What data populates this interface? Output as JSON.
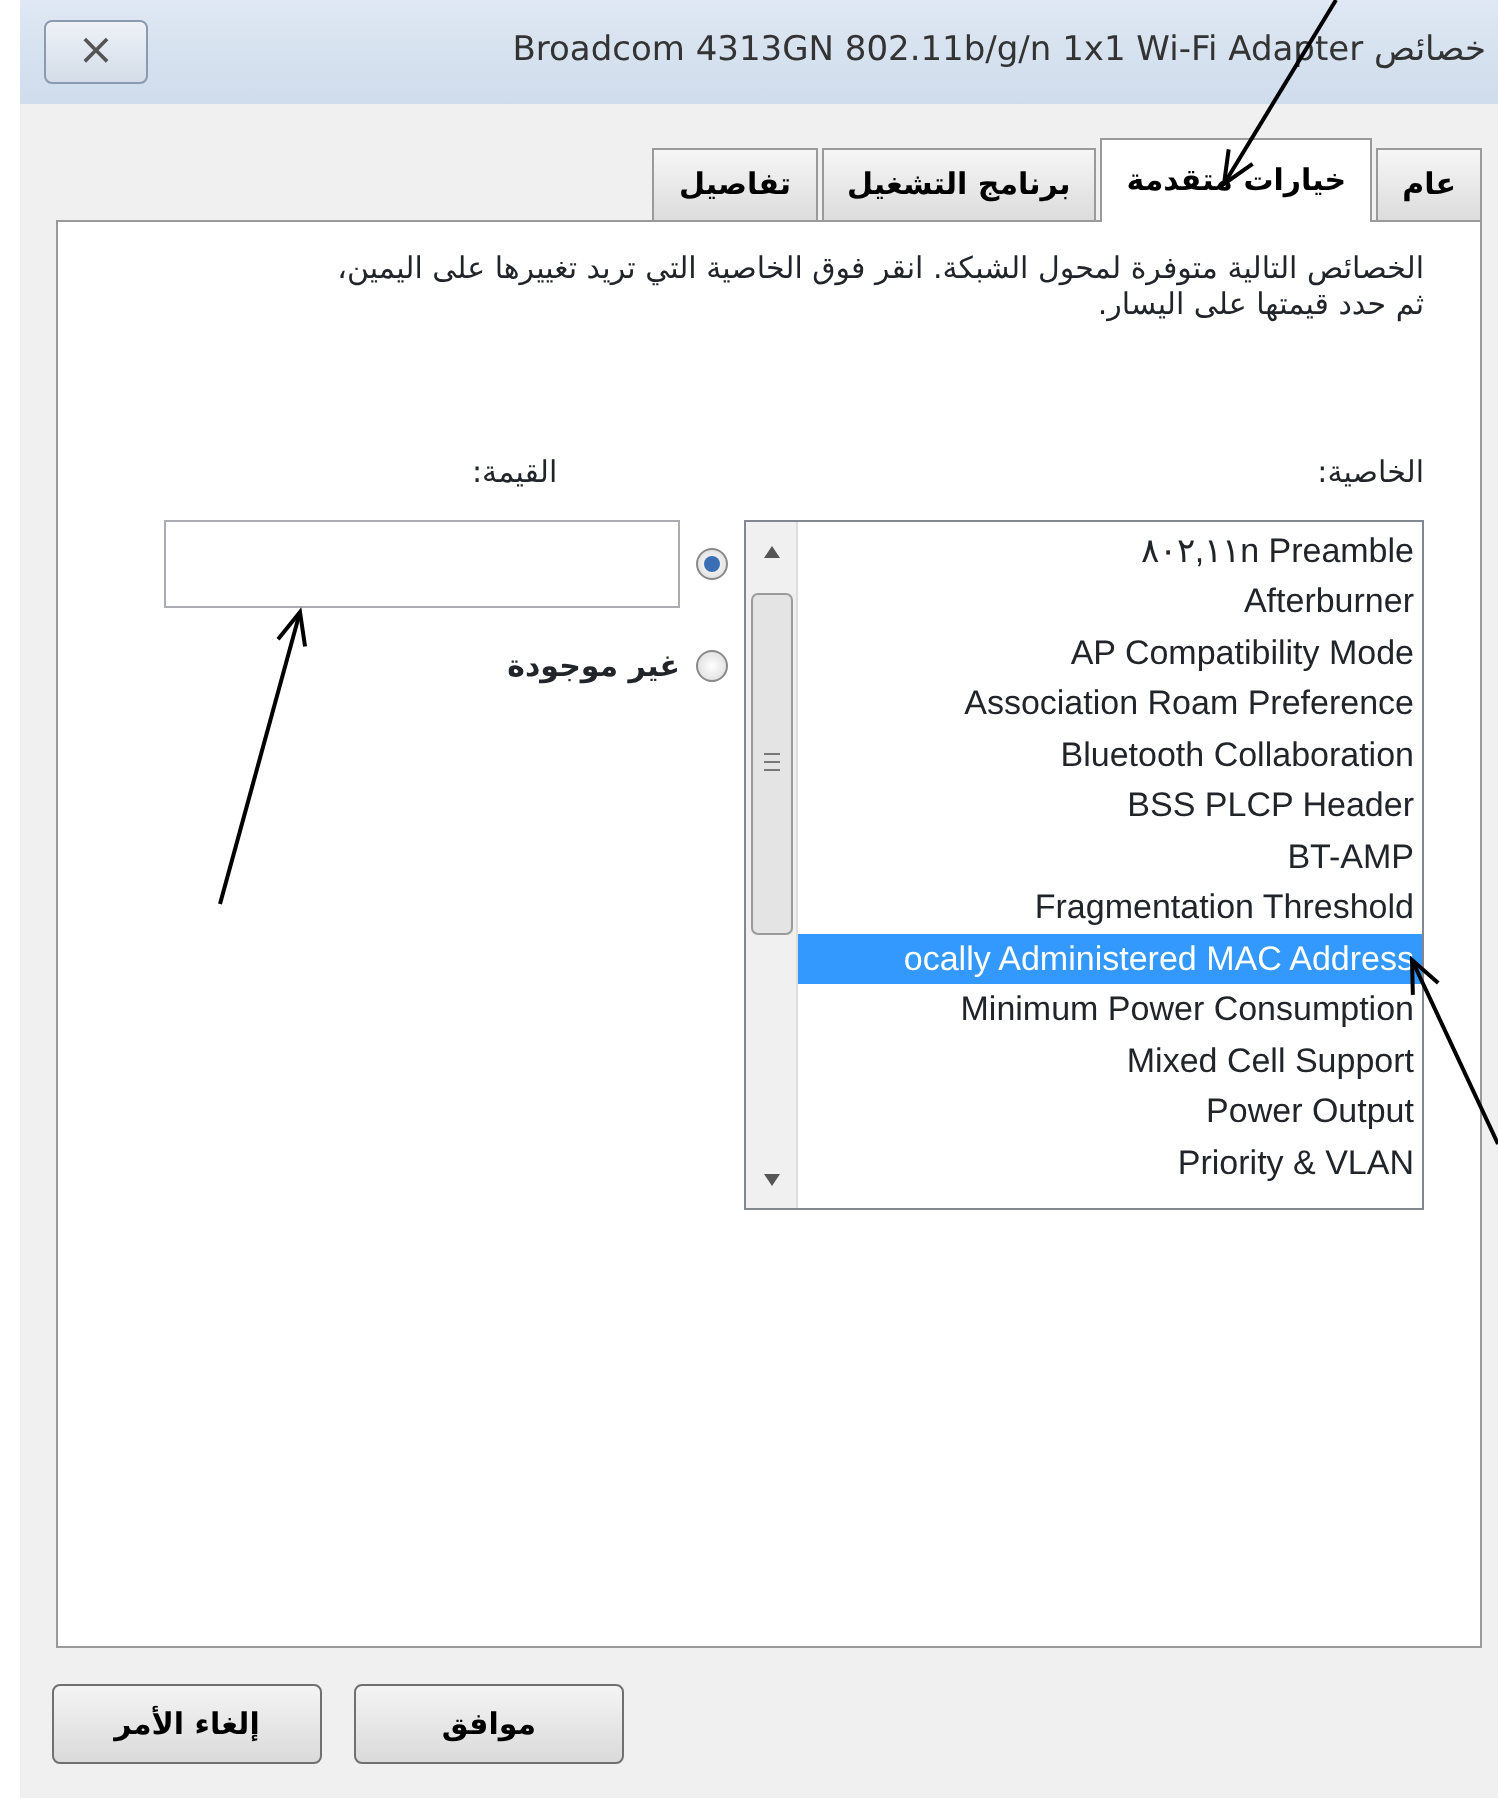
{
  "window": {
    "title": "خصائص Broadcom 4313GN 802.11b/g/n 1x1 Wi-Fi Adapter",
    "close_label": "×"
  },
  "tabs": [
    {
      "label": "عام",
      "selected": false
    },
    {
      "label": "خيارات متقدمة",
      "selected": true
    },
    {
      "label": "برنامج التشغيل",
      "selected": false
    },
    {
      "label": "تفاصيل",
      "selected": false
    }
  ],
  "description": "الخصائص التالية متوفرة لمحول الشبكة. انقر فوق الخاصية التي تريد تغييرها على اليمين، ثم حدد قيمتها على اليسار.",
  "property_label": "الخاصية:",
  "value_label": "القيمة:",
  "properties": [
    {
      "label": "٨٠٢,١١n Preamble",
      "selected": false
    },
    {
      "label": "Afterburner",
      "selected": false
    },
    {
      "label": "AP Compatibility Mode",
      "selected": false
    },
    {
      "label": "Association Roam Preference",
      "selected": false
    },
    {
      "label": "Bluetooth Collaboration",
      "selected": false
    },
    {
      "label": "BSS PLCP Header",
      "selected": false
    },
    {
      "label": "BT-AMP",
      "selected": false
    },
    {
      "label": "Fragmentation Threshold",
      "selected": false
    },
    {
      "label": "ocally Administered MAC Address",
      "selected": true
    },
    {
      "label": "Minimum Power Consumption",
      "selected": false
    },
    {
      "label": "Mixed Cell Support",
      "selected": false
    },
    {
      "label": "Power Output",
      "selected": false
    },
    {
      "label": "Priority & VLAN",
      "selected": false
    }
  ],
  "value_options": [
    {
      "kind": "field",
      "selected": true
    },
    {
      "kind": "text",
      "label": "غير موجودة",
      "selected": false
    }
  ],
  "buttons": [
    {
      "label": "موافق"
    },
    {
      "label": "إلغاء الأمر"
    }
  ],
  "annotations": [
    {
      "kind": "arrow"
    },
    {
      "kind": "arrow"
    },
    {
      "kind": "arrow"
    }
  ]
}
